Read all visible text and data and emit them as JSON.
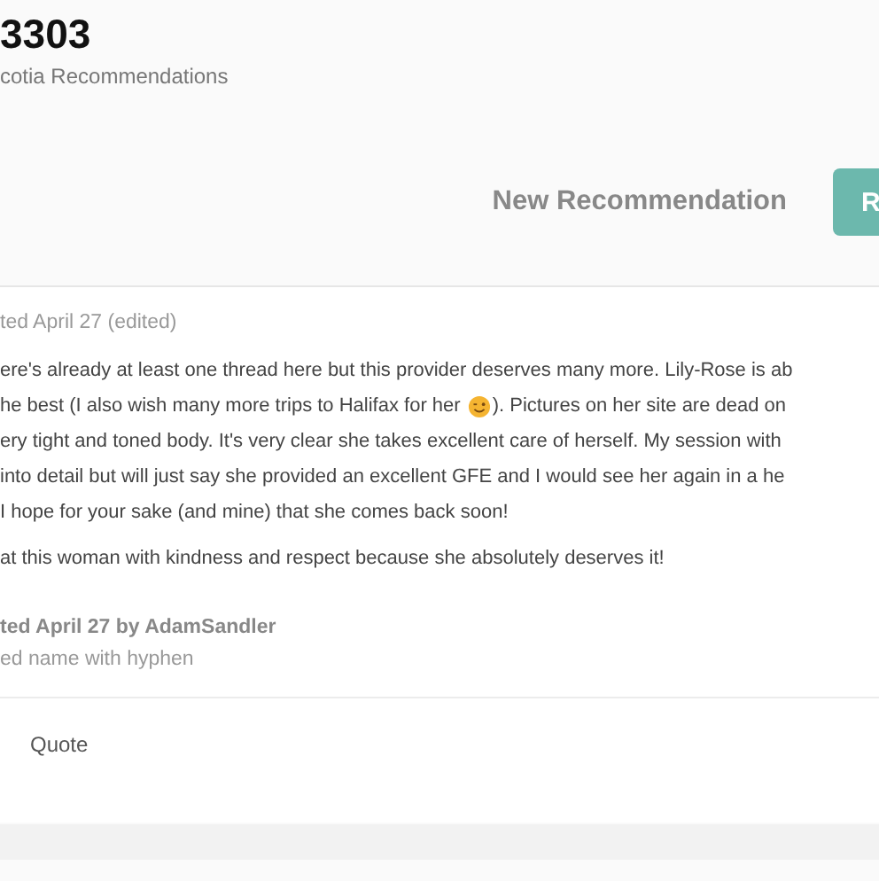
{
  "header": {
    "title": "3303",
    "subtitle": "cotia Recommendations"
  },
  "actions": [
    {
      "kind": "link",
      "label": "New Recommendation"
    },
    {
      "kind": "primary",
      "label": "R"
    }
  ],
  "post": {
    "meta": "ted April 27 (edited)",
    "body_lines": [
      {
        "parts": [
          "ere's already at least one thread here but this provider deserves many more. Lily-Rose is ab"
        ]
      },
      {
        "parts": [
          "he best (I also wish many more trips to Halifax for her",
          "). Pictures on her site are dead on"
        ]
      },
      {
        "parts": [
          "ery tight and toned body. It's very clear she takes excellent care of herself. My session with"
        ]
      },
      {
        "parts": [
          "into detail but will just say she provided an excellent GFE and I would see her again in a he"
        ]
      },
      {
        "parts": [
          " I hope for your sake (and mine) that she comes back soon!"
        ]
      }
    ],
    "closing": "at this woman with kindness and respect because she absolutely deserves it!",
    "edit_note": "ted April 27 by AdamSandler",
    "edit_reason": "ed name with hyphen",
    "footer_action": "Quote"
  }
}
